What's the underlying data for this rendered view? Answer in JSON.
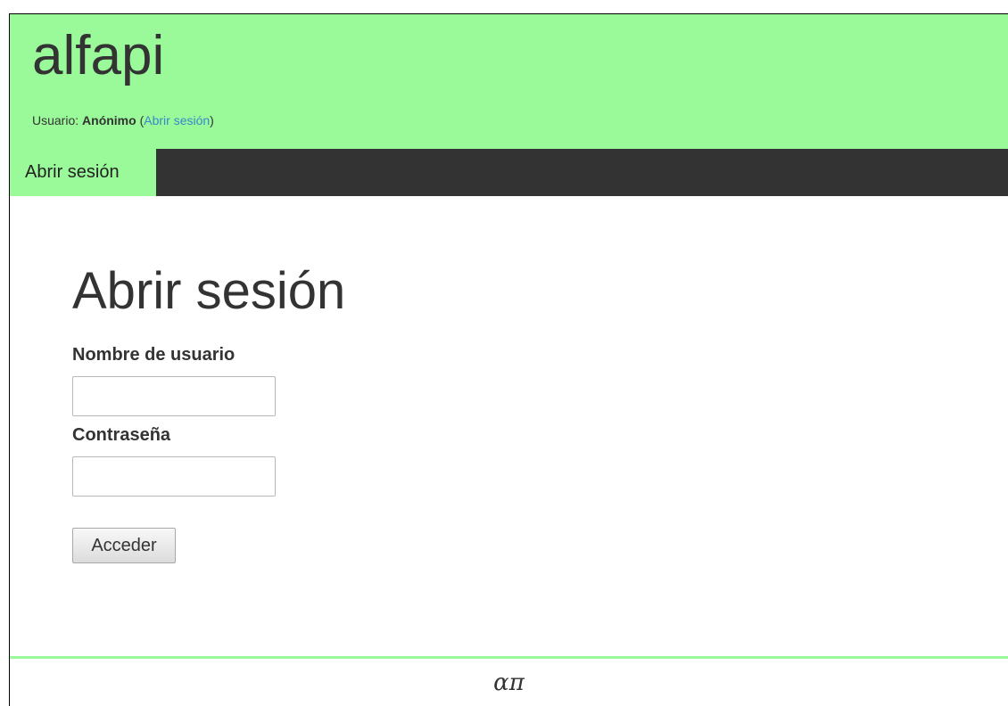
{
  "header": {
    "site_title": "alfapi",
    "user_prefix": "Usuario: ",
    "user_name": "Anónimo",
    "open_paren": " (",
    "login_link": "Abrir sesión",
    "close_paren": ")",
    "background_color": "#9afa9a"
  },
  "nav": {
    "active_tab": "Abrir sesión",
    "bar_color": "#333333"
  },
  "login_form": {
    "title": "Abrir sesión",
    "username_label": "Nombre de usuario",
    "username_value": "",
    "password_label": "Contraseña",
    "password_value": "",
    "submit_label": "Acceder"
  },
  "footer": {
    "mark": "απ",
    "accent_color": "#9afa9a"
  }
}
